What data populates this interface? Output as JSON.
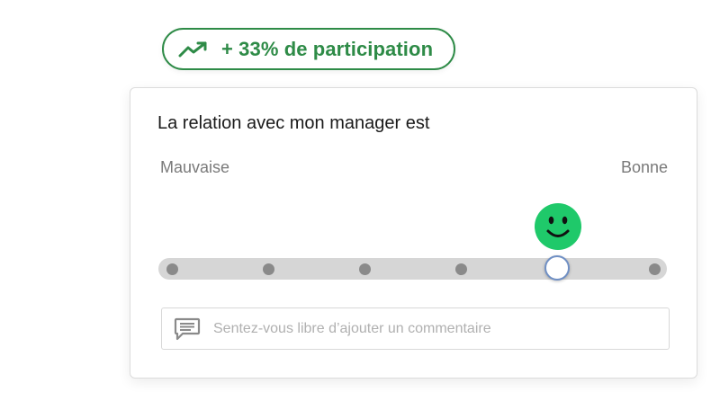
{
  "badge": {
    "icon": "trending-up-icon",
    "text": "+ 33% de participation",
    "color": "#2e8b47"
  },
  "survey": {
    "question": "La relation avec mon manager est",
    "scale": {
      "min_label": "Mauvaise",
      "max_label": "Bonne",
      "steps": 6,
      "selected_step": 5,
      "selected_face": "happy-smiley-icon",
      "face_color": "#1fc96a"
    },
    "comment": {
      "icon": "comment-icon",
      "placeholder": "Sentez-vous libre d’ajouter un commentaire",
      "value": ""
    }
  }
}
